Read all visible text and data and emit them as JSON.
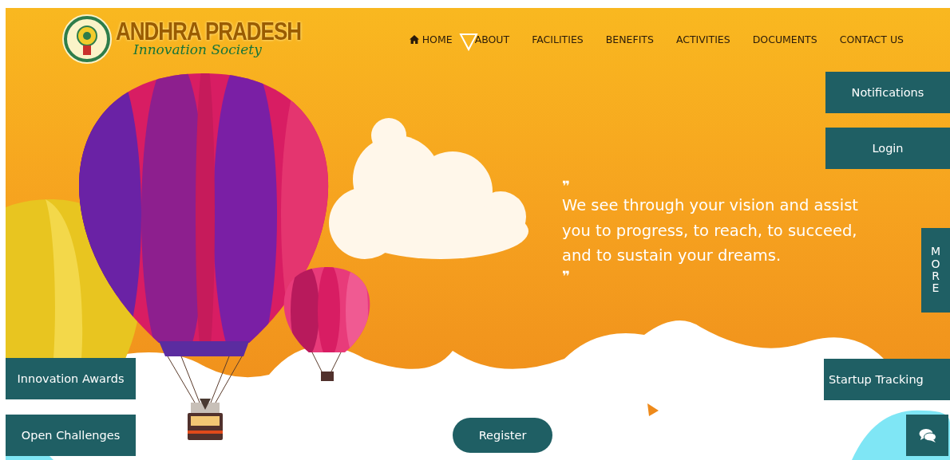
{
  "logo": {
    "title": "ANDHRA PRADESH",
    "subtitle": "Innovation Society"
  },
  "nav": [
    {
      "label": "HOME"
    },
    {
      "label": "ABOUT"
    },
    {
      "label": "FACILITIES"
    },
    {
      "label": "BENEFITS"
    },
    {
      "label": "ACTIVITIES"
    },
    {
      "label": "DOCUMENTS"
    },
    {
      "label": "CONTACT US"
    }
  ],
  "quote": {
    "open_mark": "❞",
    "text": "We see through your vision and assist you to progress, to reach, to succeed, and to sustain your dreams.",
    "close_mark": "❞"
  },
  "right_buttons": [
    "Notifications",
    "Login"
  ],
  "more_tab": "MORE",
  "left_buttons": [
    "Innovation Awards",
    "Open Challenges"
  ],
  "register_button": "Register",
  "startup_button": "Startup Tracking"
}
